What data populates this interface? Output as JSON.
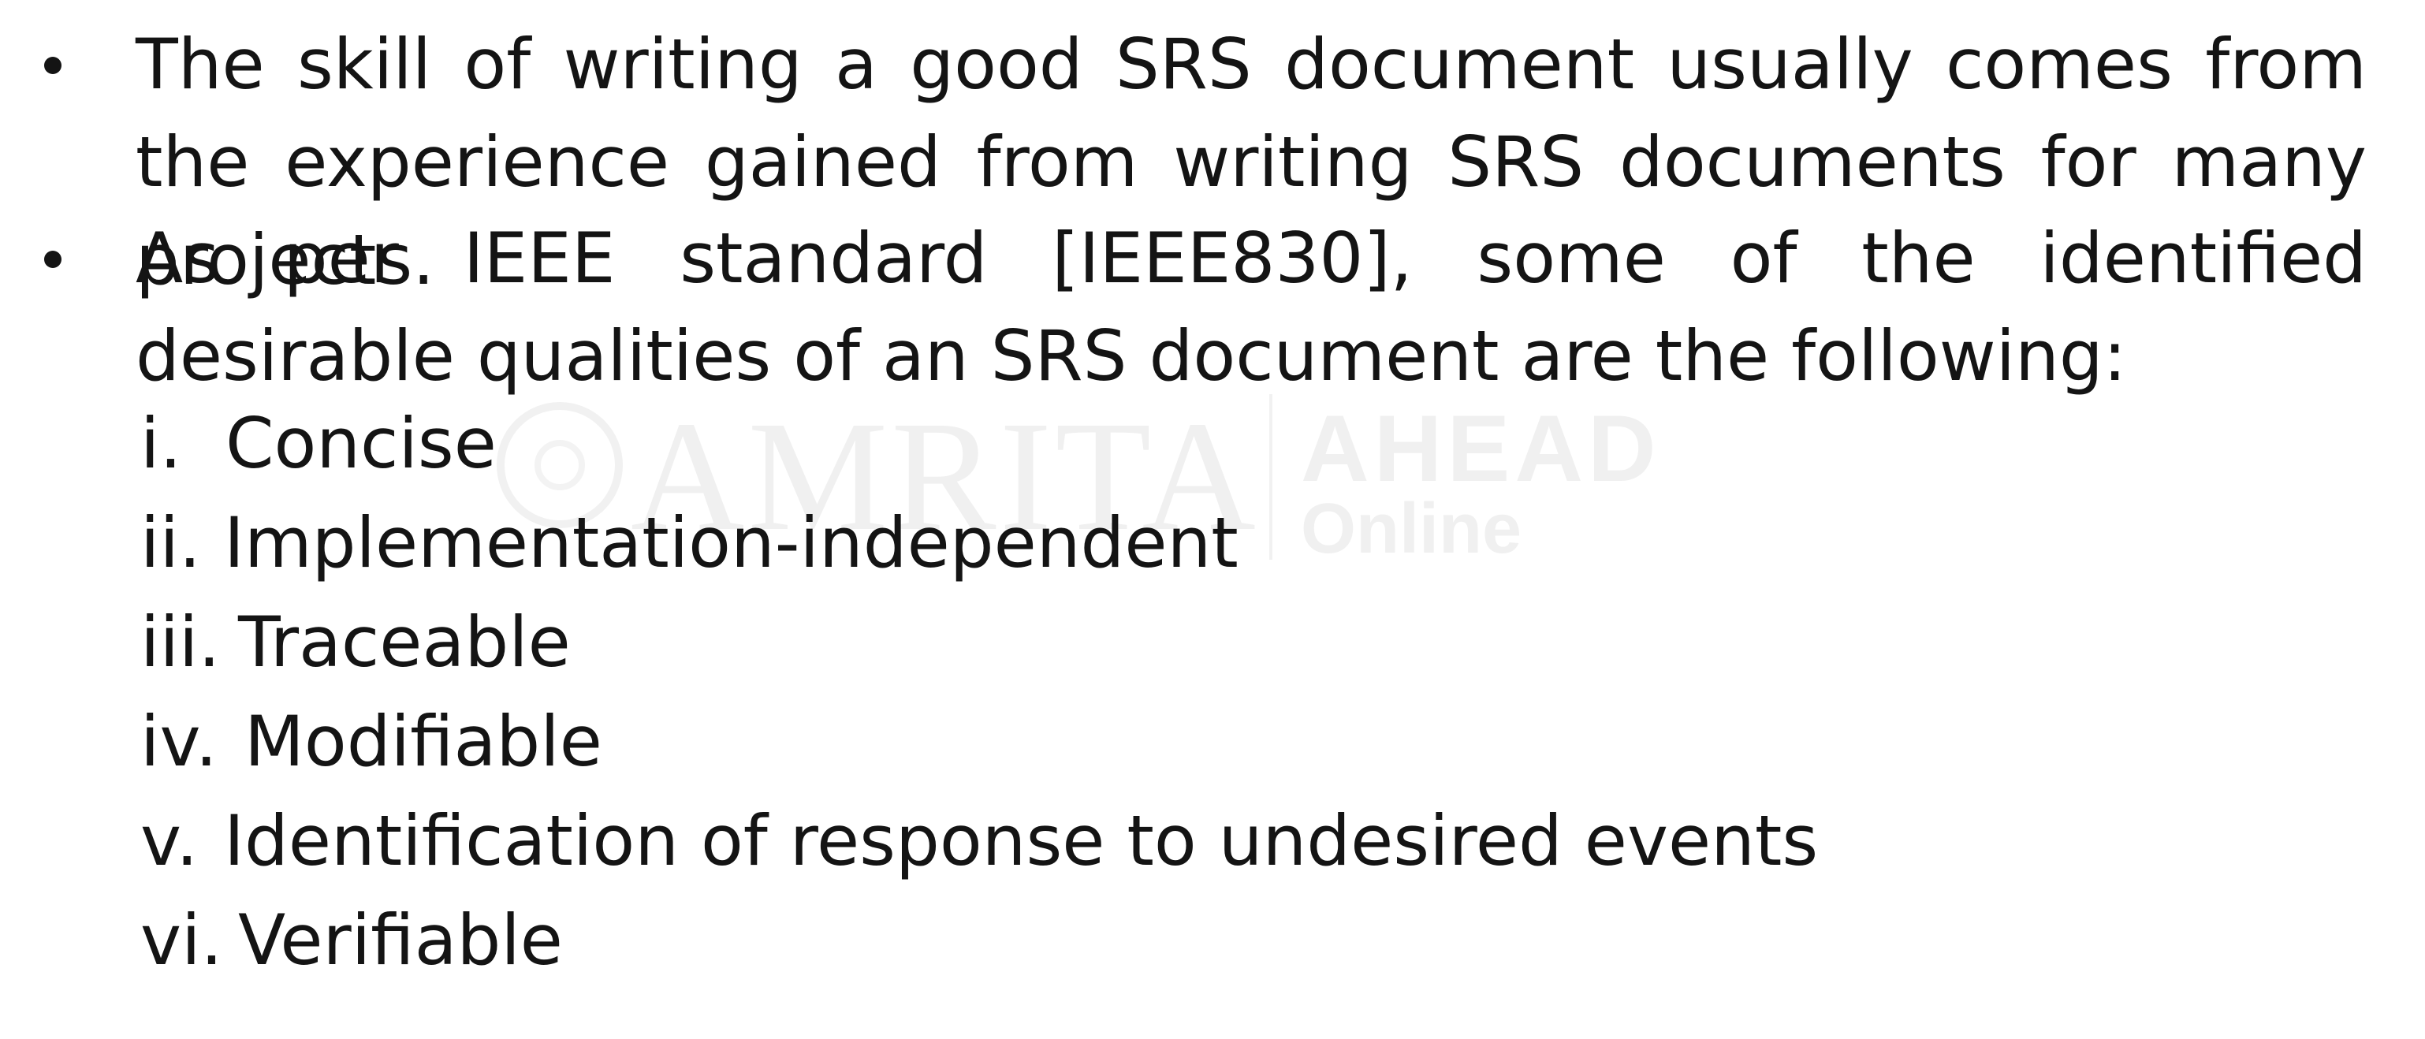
{
  "watermark": {
    "brand": "AMRITA",
    "ahead": "AHEAD",
    "online": "Online"
  },
  "bullets": [
    {
      "text": "The skill of writing a good SRS document usually comes from the experience gained from writing SRS documents for many projects."
    },
    {
      "text": "As per IEEE standard [IEEE830], some of the identified desirable qualities of an SRS document are the following:"
    }
  ],
  "qualities": [
    {
      "num": "i.",
      "label": "Concise"
    },
    {
      "num": "ii.",
      "label": "Implementation-independent"
    },
    {
      "num": "iii.",
      "label": "Traceable"
    },
    {
      "num": "iv.",
      "label": "Modifiable"
    },
    {
      "num": "v.",
      "label": "Identification of response to undesired events"
    },
    {
      "num": "vi.",
      "label": "Verifiable"
    }
  ]
}
